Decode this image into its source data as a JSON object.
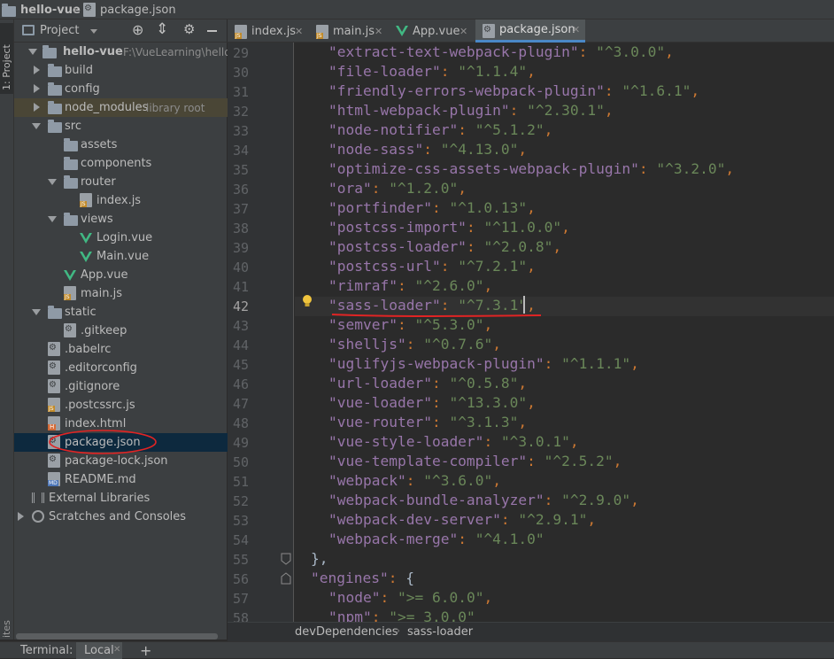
{
  "navbar": {
    "project": "hello-vue",
    "file": "package.json"
  },
  "left_strip": {
    "project_tool": "1: Project",
    "bottom_tool": "ites"
  },
  "project_panel": {
    "header_label": "Project",
    "root": {
      "name": "hello-vue",
      "path": "F:\\VueLearning\\hello-vu"
    },
    "items": [
      {
        "label": "build",
        "kind": "folder"
      },
      {
        "label": "config",
        "kind": "folder"
      },
      {
        "label": "node_modules",
        "sub": "library root",
        "kind": "folder"
      },
      {
        "label": "src",
        "kind": "folder"
      },
      {
        "label": "assets",
        "kind": "folder"
      },
      {
        "label": "components",
        "kind": "folder"
      },
      {
        "label": "router",
        "kind": "folder"
      },
      {
        "label": "index.js",
        "kind": "js"
      },
      {
        "label": "views",
        "kind": "folder"
      },
      {
        "label": "Login.vue",
        "kind": "vue"
      },
      {
        "label": "Main.vue",
        "kind": "vue"
      },
      {
        "label": "App.vue",
        "kind": "vue"
      },
      {
        "label": "main.js",
        "kind": "js"
      },
      {
        "label": "static",
        "kind": "folder"
      },
      {
        "label": ".gitkeep",
        "kind": "config"
      },
      {
        "label": ".babelrc",
        "kind": "config"
      },
      {
        "label": ".editorconfig",
        "kind": "config"
      },
      {
        "label": ".gitignore",
        "kind": "config"
      },
      {
        "label": ".postcssrc.js",
        "kind": "js"
      },
      {
        "label": "index.html",
        "kind": "html"
      },
      {
        "label": "package.json",
        "kind": "config",
        "selected": true
      },
      {
        "label": "package-lock.json",
        "kind": "config"
      },
      {
        "label": "README.md",
        "kind": "md"
      },
      {
        "label": "External Libraries",
        "kind": "library"
      },
      {
        "label": "Scratches and Consoles",
        "kind": "scratch"
      }
    ]
  },
  "tabs": [
    {
      "label": "index.js"
    },
    {
      "label": "main.js"
    },
    {
      "label": "App.vue"
    },
    {
      "label": "package.json",
      "active": true
    }
  ],
  "editor": {
    "current_line": "42",
    "lines": [
      {
        "n": "29",
        "key": "\"extract-text-webpack-plugin\"",
        "val": "\"^3.0.0\""
      },
      {
        "n": "30",
        "key": "\"file-loader\"",
        "val": "\"^1.1.4\""
      },
      {
        "n": "31",
        "key": "\"friendly-errors-webpack-plugin\"",
        "val": "\"^1.6.1\""
      },
      {
        "n": "32",
        "key": "\"html-webpack-plugin\"",
        "val": "\"^2.30.1\""
      },
      {
        "n": "33",
        "key": "\"node-notifier\"",
        "val": "\"^5.1.2\""
      },
      {
        "n": "34",
        "key": "\"node-sass\"",
        "val": "\"^4.13.0\""
      },
      {
        "n": "35",
        "key": "\"optimize-css-assets-webpack-plugin\"",
        "val": "\"^3.2.0\""
      },
      {
        "n": "36",
        "key": "\"ora\"",
        "val": "\"^1.2.0\""
      },
      {
        "n": "37",
        "key": "\"portfinder\"",
        "val": "\"^1.0.13\""
      },
      {
        "n": "38",
        "key": "\"postcss-import\"",
        "val": "\"^11.0.0\""
      },
      {
        "n": "39",
        "key": "\"postcss-loader\"",
        "val": "\"^2.0.8\""
      },
      {
        "n": "40",
        "key": "\"postcss-url\"",
        "val": "\"^7.2.1\""
      },
      {
        "n": "41",
        "key": "\"rimraf\"",
        "val": "\"^2.6.0\""
      },
      {
        "n": "42",
        "key": "\"sass-loader\"",
        "val": "\"^7.3.1\""
      },
      {
        "n": "43",
        "key": "\"semver\"",
        "val": "\"^5.3.0\""
      },
      {
        "n": "44",
        "key": "\"shelljs\"",
        "val": "\"^0.7.6\""
      },
      {
        "n": "45",
        "key": "\"uglifyjs-webpack-plugin\"",
        "val": "\"^1.1.1\""
      },
      {
        "n": "46",
        "key": "\"url-loader\"",
        "val": "\"^0.5.8\""
      },
      {
        "n": "47",
        "key": "\"vue-loader\"",
        "val": "\"^13.3.0\""
      },
      {
        "n": "48",
        "key": "\"vue-router\"",
        "val": "\"^3.1.3\""
      },
      {
        "n": "49",
        "key": "\"vue-style-loader\"",
        "val": "\"^3.0.1\""
      },
      {
        "n": "50",
        "key": "\"vue-template-compiler\"",
        "val": "\"^2.5.2\""
      },
      {
        "n": "51",
        "key": "\"webpack\"",
        "val": "\"^3.6.0\""
      },
      {
        "n": "52",
        "key": "\"webpack-bundle-analyzer\"",
        "val": "\"^2.9.0\""
      },
      {
        "n": "53",
        "key": "\"webpack-dev-server\"",
        "val": "\"^2.9.1\""
      },
      {
        "n": "54",
        "key": "\"webpack-merge\"",
        "val": "\"^4.1.0\""
      },
      {
        "n": "55",
        "raw": "},",
        "indent": 0
      },
      {
        "n": "56",
        "key": "\"engines\"",
        "raw_after": "{",
        "indent": 0
      },
      {
        "n": "57",
        "key": "\"node\"",
        "val": "\">= 6.0.0\""
      },
      {
        "n": "58",
        "key": "\"npm\"",
        "val": "\">= 3.0.0\""
      }
    ]
  },
  "breadcrumb": {
    "parts": [
      "devDependencies",
      "sass-loader"
    ]
  },
  "bottom": {
    "terminal": "Terminal:",
    "local": "Local",
    "add": "+"
  },
  "colors": {
    "annotation": "#e02424",
    "selection": "#0d293e",
    "accent": "#4a88c7"
  }
}
